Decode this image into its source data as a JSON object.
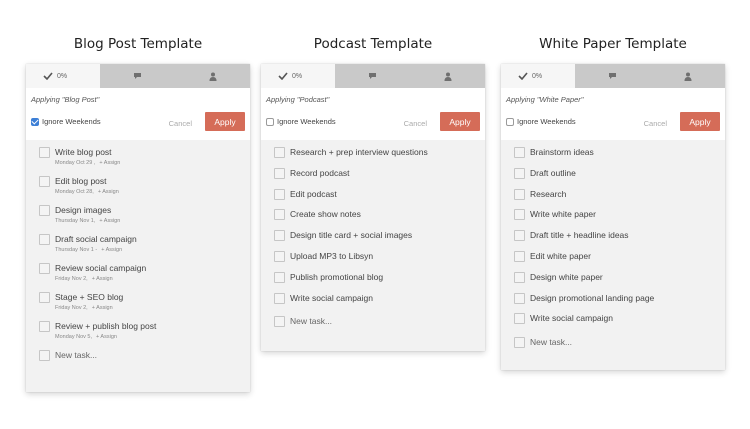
{
  "templates": [
    {
      "heading": "Blog Post Template",
      "progress": "0%",
      "applying_text": "Applying \"Blog Post\"",
      "ignore_weekends_label": "Ignore Weekends",
      "ignore_weekends_checked": true,
      "cancel_label": "Cancel",
      "apply_label": "Apply",
      "tasks": [
        {
          "name": "Write blog post",
          "date": "Monday Oct 29 ,",
          "assign": "+ Assign"
        },
        {
          "name": "Edit blog post",
          "date": "Monday Oct 28,",
          "assign": "+ Assign"
        },
        {
          "name": "Design images",
          "date": "Thursday Nov 1,",
          "assign": "+ Assign"
        },
        {
          "name": "Draft social campaign",
          "date": "Thursday Nov 1 -",
          "assign": "+ Assign"
        },
        {
          "name": "Review social campaign",
          "date": "Friday Nov 2,",
          "assign": "+ Assign"
        },
        {
          "name": "Stage + SEO blog",
          "date": "Friday Nov 2,",
          "assign": "+ Assign"
        },
        {
          "name": "Review + publish blog post",
          "date": "Monday Nov 5,",
          "assign": "+ Assign"
        }
      ],
      "new_task_label": "New task..."
    },
    {
      "heading": "Podcast Template",
      "progress": "0%",
      "applying_text": "Applying \"Podcast\"",
      "ignore_weekends_label": "Ignore Weekends",
      "ignore_weekends_checked": false,
      "cancel_label": "Cancel",
      "apply_label": "Apply",
      "tasks": [
        {
          "name": "Research + prep interview questions"
        },
        {
          "name": "Record podcast"
        },
        {
          "name": "Edit podcast"
        },
        {
          "name": "Create show notes"
        },
        {
          "name": "Design title card + social images"
        },
        {
          "name": "Upload MP3 to Libsyn"
        },
        {
          "name": "Publish promotional blog"
        },
        {
          "name": "Write social campaign"
        }
      ],
      "new_task_label": "New task..."
    },
    {
      "heading": "White Paper Template",
      "progress": "0%",
      "applying_text": "Applying \"White Paper\"",
      "ignore_weekends_label": "Ignore Weekends",
      "ignore_weekends_checked": false,
      "cancel_label": "Cancel",
      "apply_label": "Apply",
      "tasks": [
        {
          "name": "Brainstorm ideas"
        },
        {
          "name": "Draft outline"
        },
        {
          "name": "Research"
        },
        {
          "name": "Write white paper"
        },
        {
          "name": "Draft title + headline ideas"
        },
        {
          "name": "Edit white paper"
        },
        {
          "name": "Design white paper"
        },
        {
          "name": "Design promotional landing page"
        },
        {
          "name": "Write social campaign"
        }
      ],
      "new_task_label": "New task..."
    }
  ],
  "icons": {
    "progress": "checkmark-icon",
    "comments": "speech-bubble-icon",
    "people": "person-icon"
  },
  "colors": {
    "apply_button": "#d56c58",
    "checkbox_checked": "#3d7fd6",
    "tabbar": "#c9c9c9",
    "panel_bg": "#f2f2f2"
  }
}
